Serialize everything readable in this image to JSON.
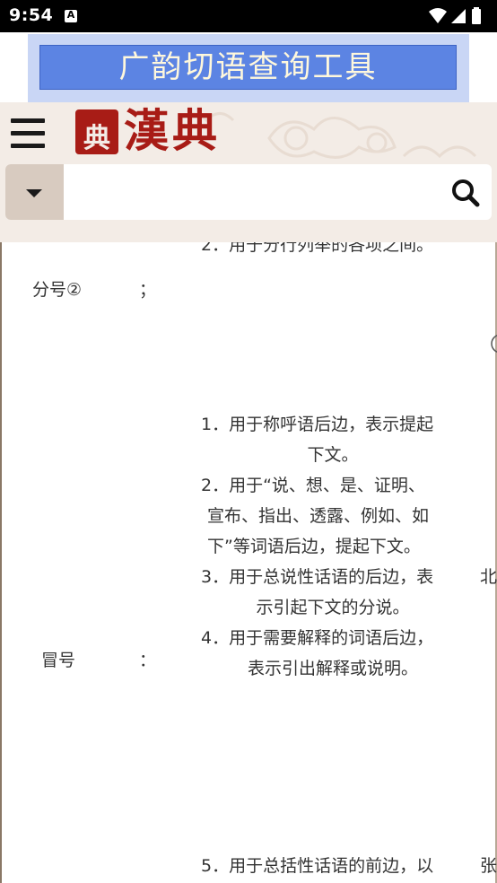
{
  "status_bar": {
    "time": "9:54",
    "notification_icon": "A",
    "icons": [
      "wifi-icon",
      "signal-icon",
      "battery-icon"
    ]
  },
  "ad": {
    "text": "广韵切语查询工具"
  },
  "header": {
    "seal_text": "典",
    "site_title": "漢典",
    "search": {
      "placeholder": "",
      "value": ""
    }
  },
  "table": {
    "partial_top_item": "2．用于分行列举的各项之间。",
    "rows": [
      {
        "name": "分号②",
        "symbol": "；",
        "usage": []
      },
      {
        "name": "冒号",
        "symbol": "：",
        "usage": [
          "1．用于称呼语后边，表示提起",
          "下文。",
          "2．用于“说、想、是、证明、",
          "宣布、指出、透露、例如、如",
          "下”等词语后边，提起下文。",
          "3．用于总说性话语的后边，表",
          "示引起下文的分说。",
          "4．用于需要解释的词语后边，",
          "表示引出解释或说明。",
          "5．用于总括性话语的前边，以"
        ]
      }
    ],
    "right_edge_fragments": [
      "北",
      "张"
    ]
  },
  "colors": {
    "header_bg": "#f3ece6",
    "brand_red": "#a81c16",
    "dropdown_bg": "#d8cbc0",
    "ad_blue": "#5c84e3",
    "text": "#333333"
  }
}
